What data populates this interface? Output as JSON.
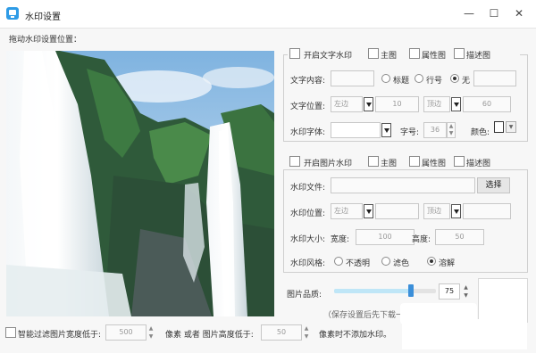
{
  "window": {
    "title": "水印设置",
    "minimize": "—",
    "maximize": "☐",
    "close": "✕",
    "icon": "app-icon"
  },
  "preview": {
    "label": "拖动水印设置位置："
  },
  "text_watermark": {
    "enable_label": "开启文字水印",
    "targets": [
      "主图",
      "属性图",
      "描述图"
    ],
    "content_label": "文字内容:",
    "content_value": "",
    "position_radios": [
      {
        "label": "标题",
        "selected": false
      },
      {
        "label": "行号",
        "selected": false
      },
      {
        "label": "无",
        "selected": true
      }
    ],
    "position_label": "文字位置:",
    "h_align": "左边",
    "h_offset": "10",
    "v_align": "顶边",
    "v_offset": "60",
    "font_label": "水印字体:",
    "font_value": "",
    "size_label": "字号:",
    "size_value": "36",
    "color_label": "颜色:"
  },
  "image_watermark": {
    "enable_label": "开启图片水印",
    "targets": [
      "主图",
      "属性图",
      "描述图"
    ],
    "file_label": "水印文件:",
    "file_value": "",
    "select_button": "选择",
    "position_label": "水印位置:",
    "h_align": "左边",
    "v_align": "顶边",
    "size_label": "水印大小:",
    "width_label": "宽度:",
    "width_value": "100",
    "height_label": "高度:",
    "height_value": "50",
    "style_label": "水印风格:",
    "styles": [
      {
        "label": "不透明",
        "selected": false
      },
      {
        "label": "滤色",
        "selected": false
      },
      {
        "label": "溶解",
        "selected": true
      }
    ]
  },
  "quality": {
    "label": "图片品质:",
    "value": "75",
    "fraction": 0.75,
    "note": "（保存设置后先下载一"
  },
  "filter": {
    "label": "智能过滤图片宽度低于:",
    "width_value": "500",
    "mid_text": "像素 或者 图片高度低于:",
    "height_value": "50",
    "tail_text": "像素时不添加水印。"
  },
  "colors": {
    "accent": "#2e9be6",
    "slider_fill": "#bfe6f7",
    "slider_thumb": "#3b8fd9"
  }
}
